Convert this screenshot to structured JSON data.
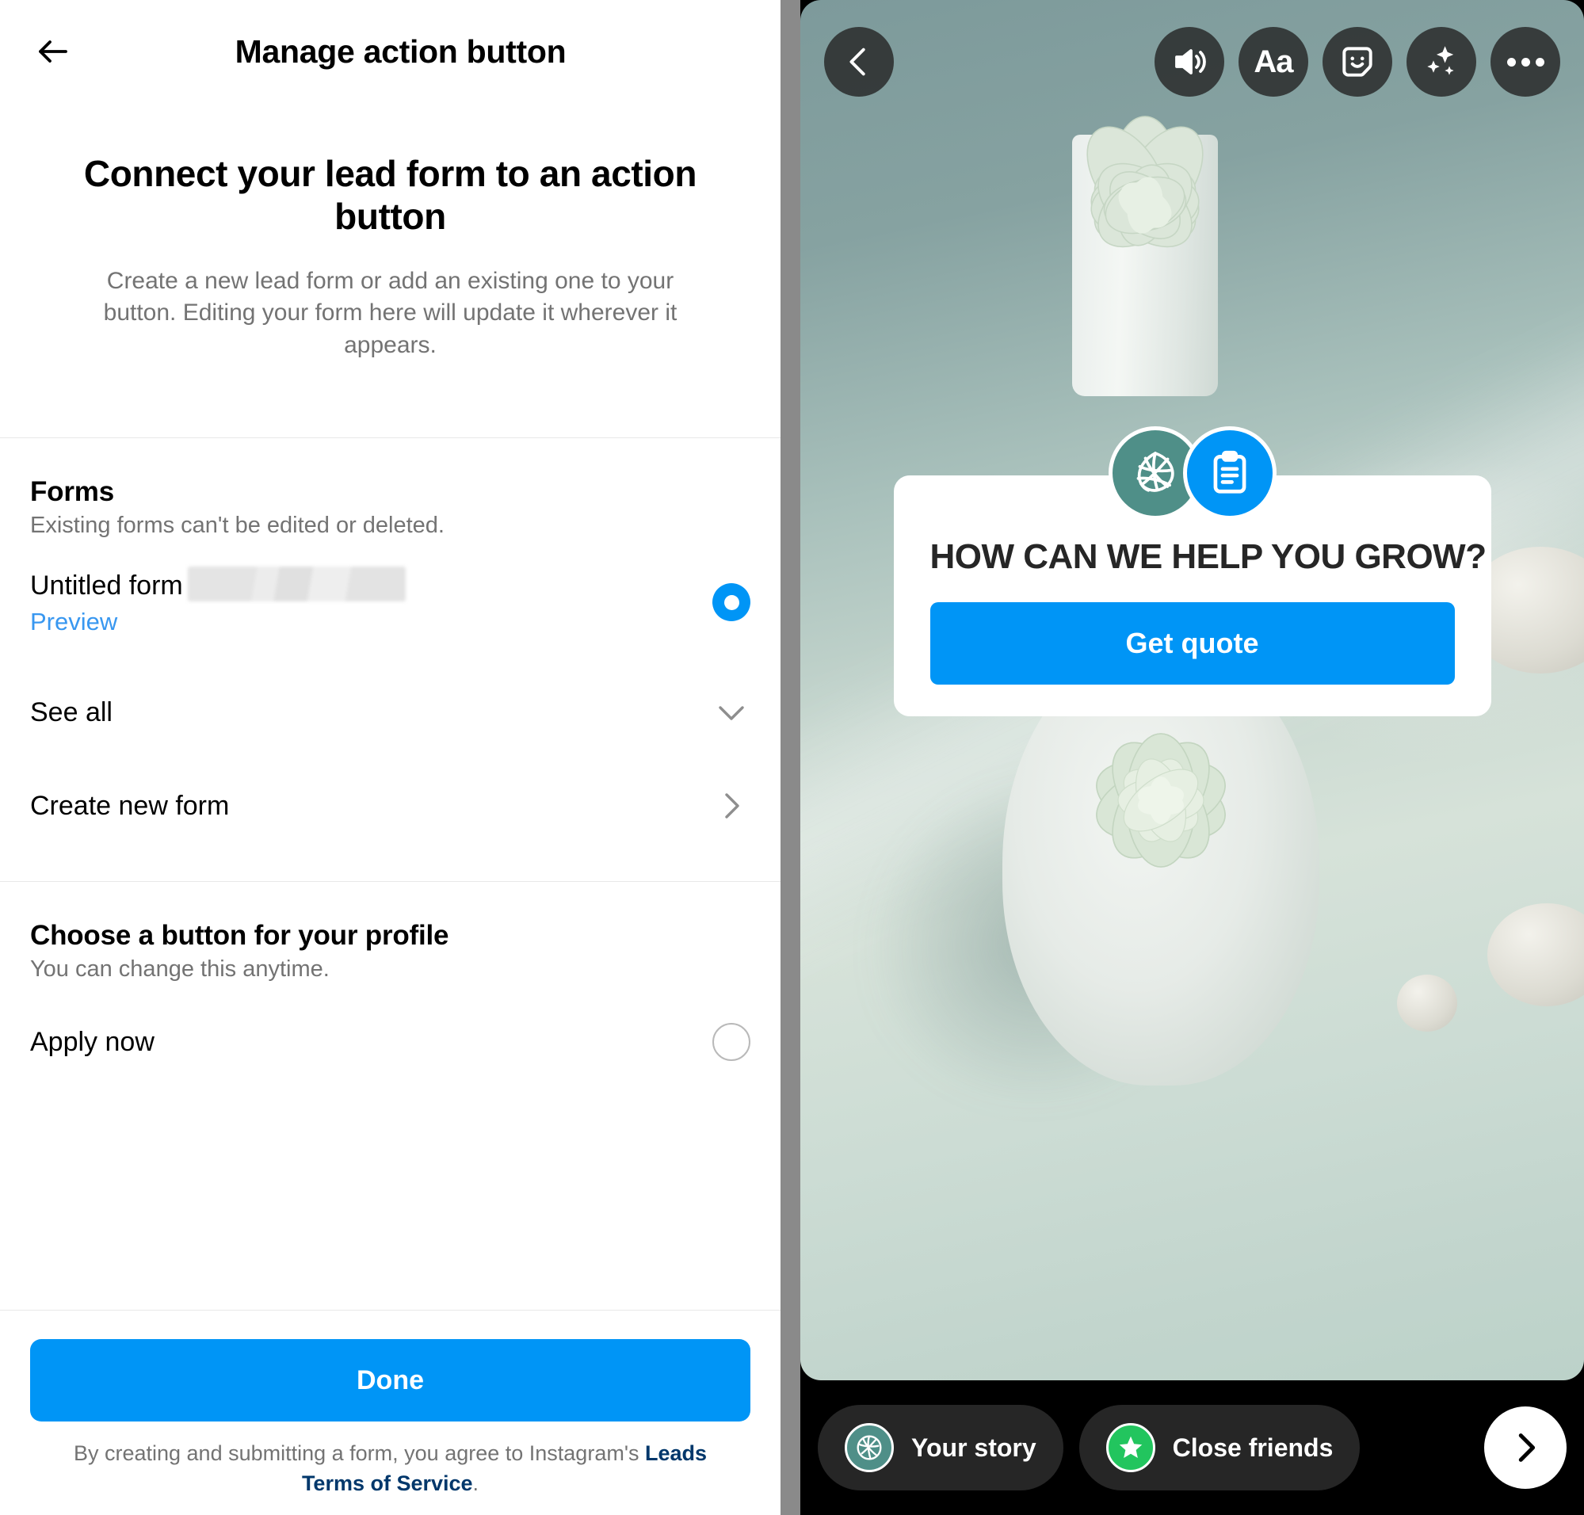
{
  "left": {
    "nav": {
      "back_icon": "arrow-left-icon",
      "title": "Manage action button"
    },
    "hero": {
      "title": "Connect your lead form to an action button",
      "subtitle": "Create a new lead form or add an existing one to your button. Editing your form here will update it wherever it appears."
    },
    "forms_section": {
      "title": "Forms",
      "subtitle": "Existing forms can't be edited or deleted.",
      "items": [
        {
          "name": "Untitled form",
          "redacted_suffix": "",
          "preview_label": "Preview",
          "selected": true
        }
      ],
      "see_all_label": "See all",
      "see_all_icon": "chevron-down-icon",
      "create_new_label": "Create new form",
      "create_new_icon": "chevron-right-icon"
    },
    "button_section": {
      "title": "Choose a button for your profile",
      "subtitle": "You can change this anytime.",
      "options": [
        {
          "label": "Apply now",
          "selected": false
        }
      ]
    },
    "footer": {
      "done_label": "Done",
      "terms_prefix": "By creating and submitting a form, you agree to Instagram's ",
      "terms_link": "Leads Terms of Service",
      "terms_suffix": "."
    },
    "colors": {
      "accent": "#0095f6",
      "link": "#3897f0",
      "muted": "#737373",
      "terms_link": "#00376b"
    }
  },
  "right": {
    "topbar": {
      "back_icon": "chevron-left-icon",
      "items": [
        {
          "icon": "speaker-volume-icon",
          "label": ""
        },
        {
          "icon": "text-aa-icon",
          "label": "Aa"
        },
        {
          "icon": "sticker-smiley-icon",
          "label": ""
        },
        {
          "icon": "sparkles-icon",
          "label": ""
        },
        {
          "icon": "more-options-icon",
          "label": ""
        }
      ]
    },
    "lead_card": {
      "avatar_icon": "leaf-globe-logo-icon",
      "form_badge_icon": "clipboard-form-icon",
      "headline": "HOW CAN WE HELP YOU GROW?",
      "cta_label": "Get quote",
      "cta_color": "#0095f6"
    },
    "share_bar": {
      "your_story_label": "Your story",
      "your_story_icon": "leaf-globe-logo-icon",
      "close_friends_label": "Close friends",
      "close_friends_icon": "star-icon",
      "close_friends_color": "#22c55e",
      "next_icon": "chevron-right-icon"
    },
    "photo": {
      "description": "Two pale succulent plants in white pots on a mint-green surface with pebbles"
    }
  }
}
